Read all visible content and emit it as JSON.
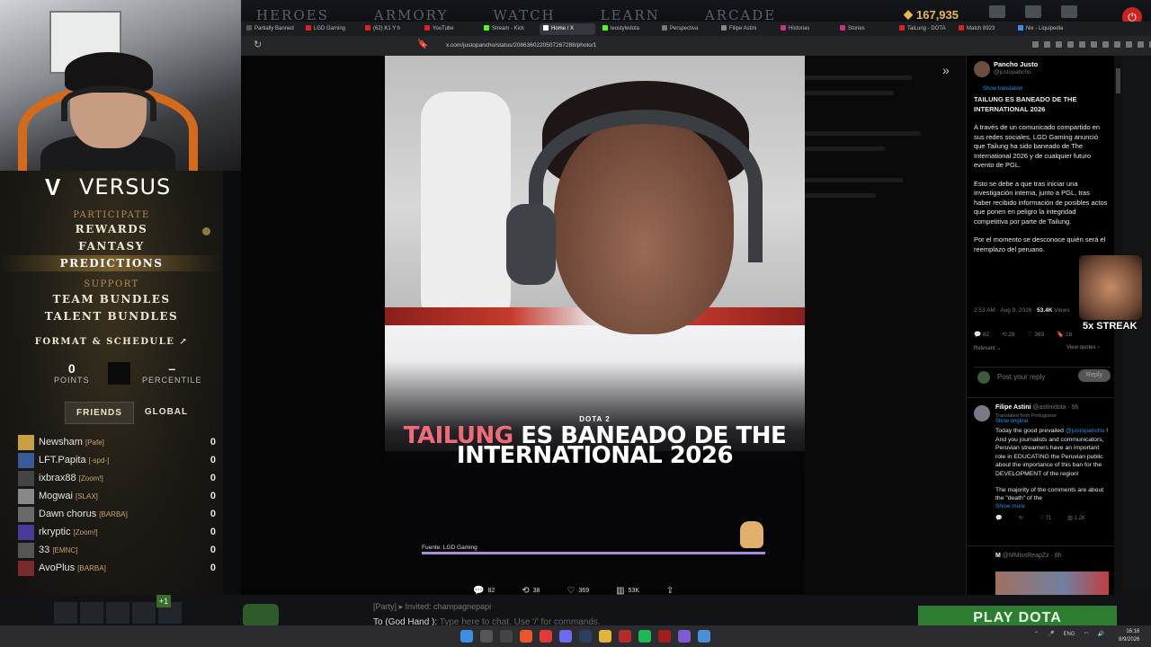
{
  "game_top": {
    "nav": [
      "HEROES",
      "ARMORY",
      "WATCH",
      "LEARN",
      "ARCADE"
    ],
    "gold": "167,935"
  },
  "left_panel": {
    "brand": "VERSUS",
    "menu": {
      "participate": "PARTICIPATE",
      "rewards": "REWARDS",
      "fantasy": "FANTASY",
      "predictions": "PREDICTIONS",
      "support": "SUPPORT",
      "team_bundles": "TEAM BUNDLES",
      "talent_bundles": "TALENT BUNDLES",
      "format": "FORMAT & SCHEDULE ↗"
    },
    "points_value": "0",
    "points_label": "POINTS",
    "percentile_value": "–",
    "percentile_label": "PERCENTILE",
    "tabs": [
      "FRIENDS",
      "GLOBAL"
    ],
    "friends": [
      {
        "name": "Newsham",
        "tag": "[Pafe]",
        "score": "0"
      },
      {
        "name": "LFT.Papita",
        "tag": "[-spd-]",
        "score": "0"
      },
      {
        "name": "ixbrax88",
        "tag": "[Zoom!]",
        "score": "0"
      },
      {
        "name": "Mogwai",
        "tag": "[SLAX]",
        "score": "0"
      },
      {
        "name": "Dawn chorus",
        "tag": "[BARBA]",
        "score": "0"
      },
      {
        "name": "rkryptic",
        "tag": "[Zoom!]",
        "score": "0"
      },
      {
        "name": "33",
        "tag": "[EMNC]",
        "score": "0"
      },
      {
        "name": "AvoPlus",
        "tag": "[BARBA]",
        "score": "0"
      }
    ]
  },
  "browser": {
    "tabs": [
      "Partially Banned",
      "LGD Gaming",
      "(62) K1 Y h",
      "YouTube",
      "Stream - Kick",
      "Home / X",
      "leostyledota",
      "Perspectiva",
      "Filipe Astini",
      "Historias",
      "Stories",
      "TaiLung - DOTA",
      "Match 8923",
      "Nix - Liquipedia"
    ],
    "url": "x.com/justopancho/status/2086360220507267288/photo/1"
  },
  "photo": {
    "dota_label": "DOTA 2",
    "title_pink": "TAILUNG",
    "title_rest": " ES BANEADO DE THE INTERNATIONAL 2026",
    "source": "Fuente: LGD Gaming"
  },
  "photo_actions": {
    "replies": "82",
    "reposts": "38",
    "likes": "369",
    "views": "53K"
  },
  "tweet": {
    "author": "Pancho Justo",
    "handle": "@justopancho",
    "show_translation": "Show translation",
    "headline": "TAILUNG ES BANEADO DE THE INTERNATIONAL 2026",
    "p1": "A través de un comunicado compartido en sus redes sociales, LGD Gaming anunció que Tailung ha sido baneado de The International 2026 y de cualquier futuro evento de PGL.",
    "p2": "Esto se debe a que tras iniciar una investigación interna, junto a PGL, tras haber recibido información de posibles actos que ponen en peligro la integridad competitiva por parte de Tailung.",
    "p3": "Por el momento se desconoce quién será el reemplazo del peruano.",
    "time": "2:53 AM · Aug 9, 2026 · ",
    "views_num": "53.4K",
    "views_word": " Views",
    "stats": {
      "replies": "82",
      "reposts": "28",
      "likes": "369",
      "bookmarks": "18"
    },
    "relevant": "Relevant ⌄",
    "view_quotes": "View quotes ›",
    "reply_placeholder": "Post your reply",
    "reply_button": "Reply"
  },
  "reply_tweet": {
    "name": "Filipe Astini",
    "handle": "@astinidota · 9h",
    "translated": "Translated from Portuguese",
    "show_original": "Show original",
    "text_a": "Today the good prevailed ",
    "mention": "@justopancho",
    "text_b": " ! And you journalists and communicators, Peruvian streamers have an important role in EDUCATING the Peruvian public about the importance of this ban for the DEVELOPMENT of the region!",
    "text_c": "The majority of the comments are about the \"death\" of the",
    "show_more": "Show more",
    "stats": {
      "replies": "",
      "reposts": "",
      "likes": "71",
      "views": "1.2K"
    }
  },
  "third_tweet": {
    "name": "M",
    "handle": "@MMissReapZz · 8h"
  },
  "streak": "5x STREAK",
  "chat": {
    "party": "[Party]",
    "invited": "Invited: champagnepapi",
    "to": "To (God Hand ):",
    "placeholder": "Type here to chat. Use '/' for commands."
  },
  "play_button": "PLAY DOTA",
  "plus_badge": "+1",
  "clock": {
    "time": "16:16",
    "date": "8/9/2026"
  },
  "tray": {
    "lang": "ENG"
  }
}
